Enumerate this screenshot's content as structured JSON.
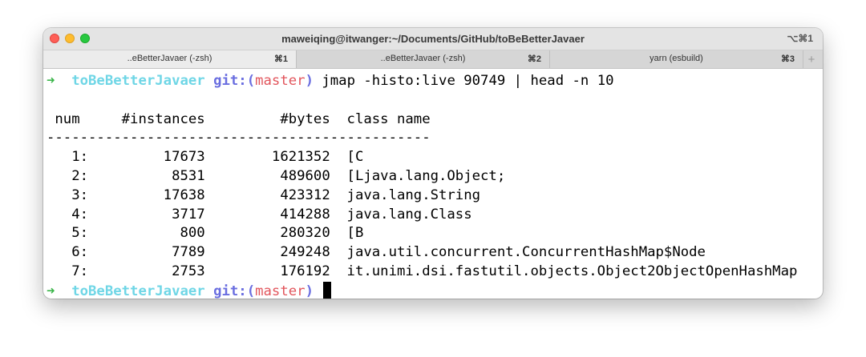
{
  "window": {
    "title": "maweiqing@itwanger:~/Documents/GitHub/toBeBetterJavaer",
    "shortcut": "⌥⌘1"
  },
  "tabs": [
    {
      "label": "..eBetterJavaer (-zsh)",
      "shortcut": "⌘1",
      "active": true
    },
    {
      "label": "..eBetterJavaer (-zsh)",
      "shortcut": "⌘2",
      "active": false
    },
    {
      "label": "yarn (esbuild)",
      "shortcut": "⌘3",
      "active": false
    }
  ],
  "new_tab_label": "+",
  "prompt": {
    "arrow": "➜",
    "dir": "toBeBetterJavaer",
    "git_prefix": "git:(",
    "branch": "master",
    "git_suffix": ")"
  },
  "command": "jmap -histo:live 90749 | head -n 10",
  "output": {
    "header": " num     #instances         #bytes  class name",
    "separator": "----------------------------------------------",
    "rows": [
      "   1:         17673        1621352  [C",
      "   2:          8531         489600  [Ljava.lang.Object;",
      "   3:         17638         423312  java.lang.String",
      "   4:          3717         414288  java.lang.Class",
      "   5:           800         280320  [B",
      "   6:          7789         249248  java.util.concurrent.ConcurrentHashMap$Node",
      "   7:          2753         176192  it.unimi.dsi.fastutil.objects.Object2ObjectOpenHashMap"
    ]
  },
  "colors": {
    "arrow": "#3bb54a",
    "dir": "#6fd6e6",
    "git": "#6a6ee0",
    "branch": "#e2555c"
  }
}
